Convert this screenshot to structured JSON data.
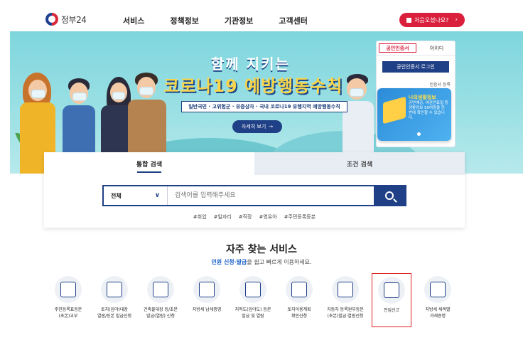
{
  "header": {
    "logo_text": "정부24",
    "nav": [
      "서비스",
      "정책정보",
      "기관정보",
      "고객센터"
    ],
    "first_visit_button": "처음오셨나요?",
    "first_visit_arrow": "›"
  },
  "banner": {
    "title_line1": "함께 지키는",
    "title_line2": "코로나19 예방행동수칙",
    "subtitle": "일반국민 · 고위험군 · 유증상자 · 국내 코로나19 유행지역 예방행동수칙",
    "more_button": "자세히 보기",
    "more_arrow": "→"
  },
  "login": {
    "tabs": [
      "공인인증서",
      "아이디"
    ],
    "button": "공인인증서 로그인",
    "link": "인증서 등록",
    "card_title": "나의생활정보",
    "card_desc": "공연예금, 여권만료일 등 생활정보 50여종을 한번에 확인할 수 있습니다."
  },
  "search": {
    "tabs": [
      "통합 검색",
      "조건 검색"
    ],
    "select_value": "전체",
    "placeholder": "검색어를 입력해주세요",
    "tags": [
      "#취업",
      "#일자리",
      "#직장",
      "#영유아",
      "#주민등록등본"
    ]
  },
  "frequent": {
    "title": "자주 찾는 서비스",
    "subtitle_highlight": "민원 신청·발급",
    "subtitle_rest": "을 쉽고 빠르게 이용하세요.",
    "items": [
      {
        "line1": "주민등록표등본",
        "line2": "(초본)교부",
        "icon": "id-card-icon"
      },
      {
        "line1": "토지(임야)대장",
        "line2": "열람/등본 발급신청",
        "icon": "monitor-map-icon"
      },
      {
        "line1": "건축물대장 등/초본",
        "line2": "발급(열람) 신청",
        "icon": "document-search-icon"
      },
      {
        "line1": "지방세 납세증명",
        "line2": "",
        "icon": "list-document-icon"
      },
      {
        "line1": "지적도(임야도) 등본",
        "line2": "발급 및 열람",
        "icon": "map-book-icon"
      },
      {
        "line1": "토지이용계획",
        "line2": "확인신청",
        "icon": "map-pin-icon"
      },
      {
        "line1": "자동차 등록원부등본",
        "line2": "(초본)발급·열람신청",
        "icon": "car-document-icon"
      },
      {
        "line1": "전입신고",
        "line2": "",
        "icon": "house-icon"
      },
      {
        "line1": "지방세 세목별",
        "line2": "과세증명",
        "icon": "chart-search-icon"
      }
    ]
  },
  "colors": {
    "brand_navy": "#1f3f86",
    "brand_red": "#d91f3c",
    "banner_bg": "#9ae0e4",
    "highlight_outline": "#e02020"
  }
}
